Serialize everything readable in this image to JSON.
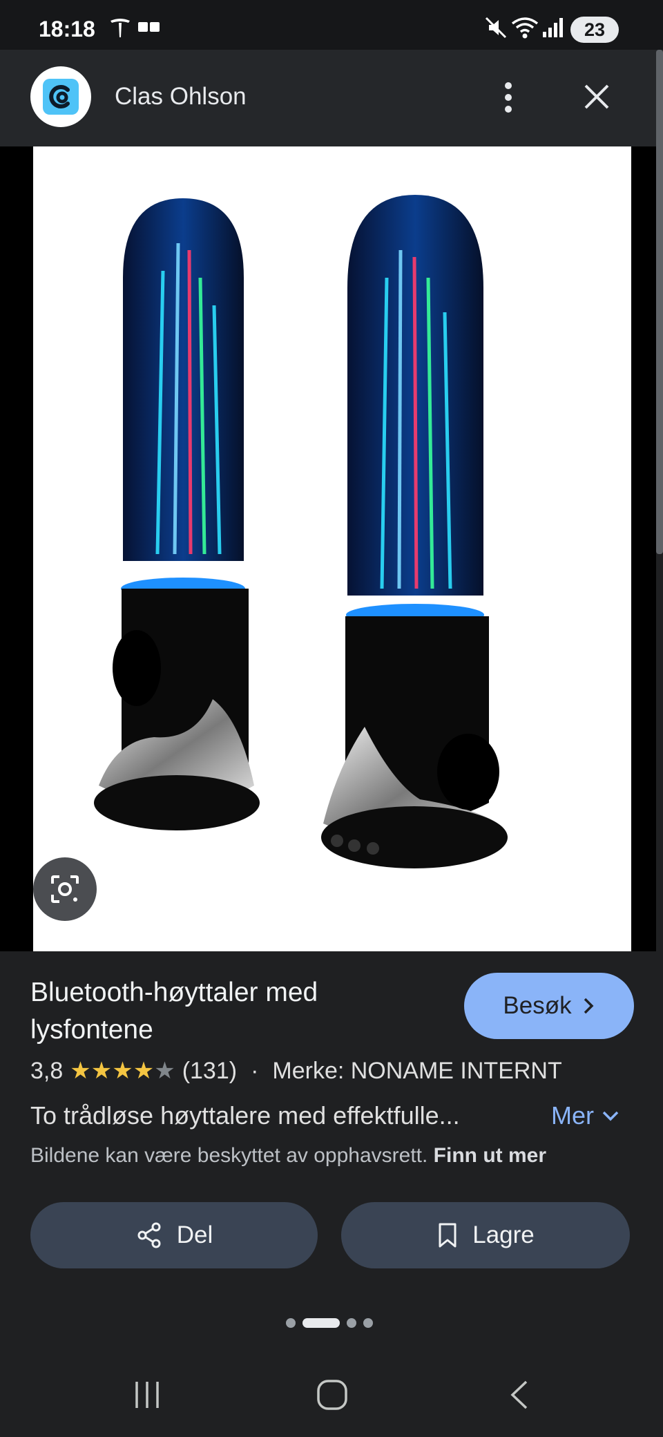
{
  "status_bar": {
    "time": "18:18",
    "battery": "23",
    "icons": [
      "tesla-icon",
      "message-icon",
      "mute-icon",
      "wifi-icon",
      "signal-icon",
      "battery-icon"
    ]
  },
  "header": {
    "site_name": "Clas Ohlson",
    "icons": [
      "site-logo-icon",
      "more-vert-icon",
      "close-icon"
    ]
  },
  "product": {
    "title": "Bluetooth-høyttaler med lysfontene",
    "visit_label": "Besøk",
    "rating": "3,8",
    "stars_filled": 4,
    "review_count": "(131)",
    "separator": "·",
    "brand": "Merke: NONAME INTERNT",
    "description": "To trådløse høyttalere med effektfulle...",
    "more_label": "Mer",
    "copyright_text": "Bildene kan være beskyttet av opphavsrett.",
    "copyright_link": "Finn ut mer"
  },
  "actions": {
    "share_label": "Del",
    "save_label": "Lagre"
  },
  "pagination": {
    "count": 4,
    "active_index": 1
  },
  "colors": {
    "background": "#1f2022",
    "accent": "#8ab4f8",
    "action_button": "#3a4454",
    "star": "#f4c542",
    "logo": "#4fc3f7"
  }
}
